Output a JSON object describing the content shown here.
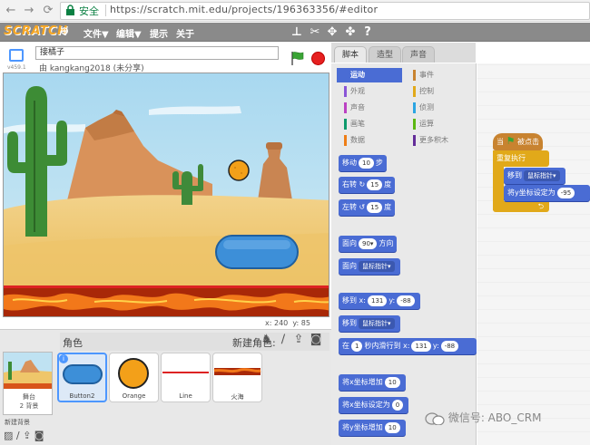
{
  "browser": {
    "secure_label": "安全",
    "url": "https://scratch.mit.edu/projects/196363356/#editor"
  },
  "menubar": {
    "logo": "SCRATCH",
    "file": "文件▼",
    "edit": "编辑▼",
    "tips": "提示",
    "about": "关于"
  },
  "project": {
    "title": "接橘子",
    "author": "由 kangkang2018 (未分享)",
    "version": "v459.1"
  },
  "stage_coords": {
    "x_label": "x:",
    "x": "240",
    "y_label": "y:",
    "y": "85"
  },
  "sprites_panel": {
    "label": "角色",
    "new_sprite": "新建角色:",
    "stage_label": "舞台",
    "stage_bg_count": "2 背景",
    "new_bg": "新建背景",
    "sprites": [
      {
        "name": "Button2"
      },
      {
        "name": "Orange"
      },
      {
        "name": "Line"
      },
      {
        "name": "火海"
      }
    ]
  },
  "tabs": [
    "脚本",
    "造型",
    "声音"
  ],
  "categories": [
    "运动",
    "事件",
    "外观",
    "控制",
    "声音",
    "侦测",
    "画笔",
    "运算",
    "数据",
    "更多积木"
  ],
  "blocks": {
    "move": [
      "移动",
      "10",
      "步"
    ],
    "turn_right": [
      "右转",
      "15",
      "度"
    ],
    "turn_left": [
      "左转",
      "15",
      "度"
    ],
    "point_dir": [
      "面向",
      "90▾",
      "方向"
    ],
    "point_to": [
      "面向",
      "鼠标指针▾"
    ],
    "goto_xy": [
      "移到 x:",
      "131",
      "y:",
      "-88"
    ],
    "goto": [
      "移到",
      "鼠标指针▾"
    ],
    "glide": [
      "在",
      "1",
      "秒内滑行到 x:",
      "131",
      "y:",
      "-88"
    ],
    "change_x": [
      "将x坐标增加",
      "10"
    ],
    "set_x": [
      "将x坐标设定为",
      "0"
    ],
    "change_y": [
      "将y坐标增加",
      "10"
    ]
  },
  "script": {
    "hat": [
      "当",
      "被点击"
    ],
    "forever": "重复执行",
    "goto": [
      "移到",
      "鼠标指针▾"
    ],
    "set_y": [
      "将y坐标设定为",
      "-95"
    ]
  },
  "watermark": "微信号: ABO_CRM",
  "colors": {
    "motion": "#4a6cd4",
    "events": "#c88330",
    "control": "#e1a91a",
    "stop": "#e62020",
    "flag": "#3aa435"
  }
}
